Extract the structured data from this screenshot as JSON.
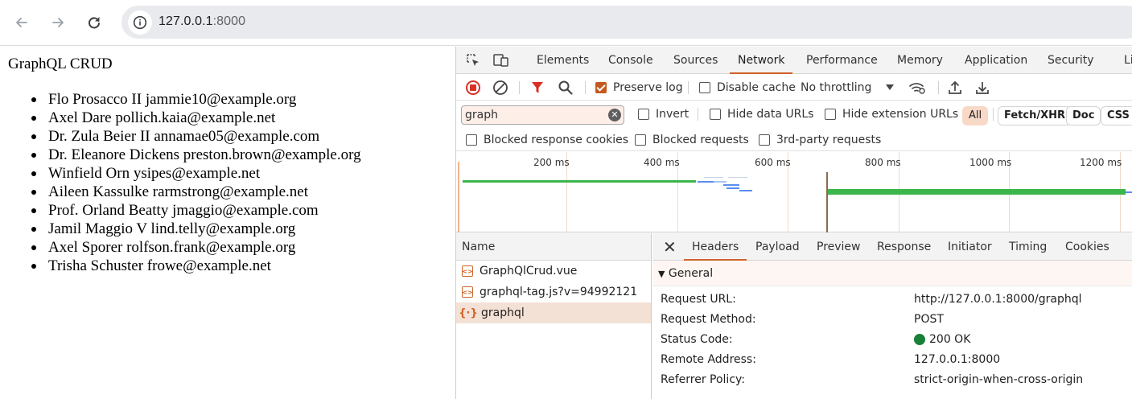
{
  "browser": {
    "url_host": "127.0.0.1",
    "url_port": ":8000"
  },
  "page": {
    "title": "GraphQL CRUD",
    "users": [
      "Flo Prosacco II jammie10@example.org",
      "Axel Dare pollich.kaia@example.net",
      "Dr. Zula Beier II annamae05@example.com",
      "Dr. Eleanore Dickens preston.brown@example.org",
      "Winfield Orn ysipes@example.net",
      "Aileen Kassulke rarmstrong@example.net",
      "Prof. Orland Beatty jmaggio@example.com",
      "Jamil Maggio V lind.telly@example.org",
      "Axel Sporer rolfson.frank@example.org",
      "Trisha Schuster frowe@example.net"
    ]
  },
  "devtools": {
    "tabs": [
      "Elements",
      "Console",
      "Sources",
      "Network",
      "Performance",
      "Memory",
      "Application",
      "Security",
      "Li"
    ],
    "active_tab": "Network",
    "toolbar": {
      "preserve_log": "Preserve log",
      "preserve_log_checked": true,
      "disable_cache": "Disable cache",
      "disable_cache_checked": false,
      "throttling": "No throttling"
    },
    "filter": {
      "value": "graph",
      "invert": "Invert",
      "hide_data_urls": "Hide data URLs",
      "hide_extension_urls": "Hide extension URLs",
      "types": [
        "All",
        "Fetch/XHR",
        "Doc",
        "CSS"
      ],
      "active_type": "All",
      "blocked_cookies": "Blocked response cookies",
      "blocked_requests": "Blocked requests",
      "third_party": "3rd-party requests"
    },
    "timeline": {
      "labels": [
        "200 ms",
        "400 ms",
        "600 ms",
        "800 ms",
        "1000 ms",
        "1200 ms"
      ]
    },
    "requests": {
      "header": "Name",
      "items": [
        {
          "name": "GraphQlCrud.vue",
          "selected": false
        },
        {
          "name": "graphql-tag.js?v=94992121",
          "selected": false
        },
        {
          "name": "graphql",
          "selected": true
        }
      ]
    },
    "detail": {
      "tabs": [
        "Headers",
        "Payload",
        "Preview",
        "Response",
        "Initiator",
        "Timing",
        "Cookies"
      ],
      "active_tab": "Headers",
      "section": "General",
      "rows": [
        {
          "key": "Request URL:",
          "value": "http://127.0.0.1:8000/graphql"
        },
        {
          "key": "Request Method:",
          "value": "POST"
        },
        {
          "key": "Status Code:",
          "value": "200 OK"
        },
        {
          "key": "Remote Address:",
          "value": "127.0.0.1:8000"
        },
        {
          "key": "Referrer Policy:",
          "value": "strict-origin-when-cross-origin"
        }
      ]
    }
  },
  "colors": {
    "accent": "#d0642a",
    "status_ok": "#188038",
    "timeline_green": "#3cb54a"
  },
  "icons": [
    "back-arrow-icon",
    "forward-arrow-icon",
    "reload-icon",
    "site-info-icon",
    "inspect-element-icon",
    "device-toolbar-icon",
    "stop-recording-icon",
    "clear-icon",
    "filter-icon",
    "search-icon",
    "network-conditions-icon",
    "import-har-icon",
    "export-har-icon",
    "close-icon"
  ]
}
